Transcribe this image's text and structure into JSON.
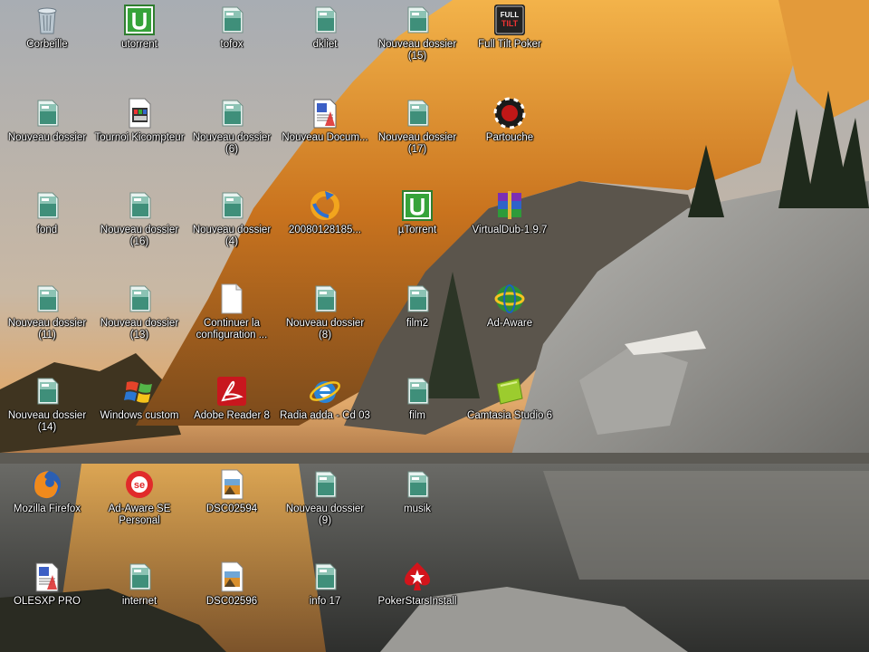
{
  "desktop": {
    "icons": [
      {
        "label": "Corbeille",
        "icon": "recycle-bin-icon",
        "col": 0,
        "row": 0
      },
      {
        "label": "Nouveau dossier",
        "icon": "folder-icon",
        "col": 0,
        "row": 1
      },
      {
        "label": "fond",
        "icon": "folder-icon",
        "col": 0,
        "row": 2
      },
      {
        "label": "Nouveau dossier (11)",
        "icon": "folder-icon",
        "col": 0,
        "row": 3
      },
      {
        "label": "Nouveau dossier (14)",
        "icon": "folder-icon",
        "col": 0,
        "row": 4
      },
      {
        "label": "Mozilla Firefox",
        "icon": "firefox-icon",
        "col": 0,
        "row": 5
      },
      {
        "label": "OLESXP PRO",
        "icon": "document-icon",
        "col": 0,
        "row": 6
      },
      {
        "label": "utorrent",
        "icon": "utorrent-icon",
        "col": 1,
        "row": 0
      },
      {
        "label": "Tournoi Kicompteur",
        "icon": "video-file-icon",
        "col": 1,
        "row": 1
      },
      {
        "label": "Nouveau dossier (16)",
        "icon": "folder-icon",
        "col": 1,
        "row": 2
      },
      {
        "label": "Nouveau dossier (13)",
        "icon": "folder-icon",
        "col": 1,
        "row": 3
      },
      {
        "label": "Windows custom",
        "icon": "windows-icon",
        "col": 1,
        "row": 4
      },
      {
        "label": "Ad-Aware SE Personal",
        "icon": "ad-aware-se-icon",
        "col": 1,
        "row": 5
      },
      {
        "label": "internet",
        "icon": "folder-icon",
        "col": 1,
        "row": 6
      },
      {
        "label": "tofox",
        "icon": "folder-icon",
        "col": 2,
        "row": 0
      },
      {
        "label": "Nouveau dossier (6)",
        "icon": "folder-icon",
        "col": 2,
        "row": 1
      },
      {
        "label": "Nouveau dossier (4)",
        "icon": "folder-icon",
        "col": 2,
        "row": 2
      },
      {
        "label": "Continuer la configuration ...",
        "icon": "blank-file-icon",
        "col": 2,
        "row": 3
      },
      {
        "label": "Adobe Reader 8",
        "icon": "adobe-reader-icon",
        "col": 2,
        "row": 4
      },
      {
        "label": "DSC02594",
        "icon": "image-file-icon",
        "col": 2,
        "row": 5
      },
      {
        "label": "DSC02596",
        "icon": "image-file-icon",
        "col": 2,
        "row": 6
      },
      {
        "label": "dkliet",
        "icon": "folder-icon",
        "col": 3,
        "row": 0
      },
      {
        "label": "Nouveau Docum...",
        "icon": "document-icon",
        "col": 3,
        "row": 1
      },
      {
        "label": "20080128185...",
        "icon": "shortcut-arrow-icon",
        "col": 3,
        "row": 2
      },
      {
        "label": "Nouveau dossier (8)",
        "icon": "folder-icon",
        "col": 3,
        "row": 3
      },
      {
        "label": "Radia adda - Cd 03",
        "icon": "internet-explorer-icon",
        "col": 3,
        "row": 4
      },
      {
        "label": "Nouveau dossier (9)",
        "icon": "folder-icon",
        "col": 3,
        "row": 5
      },
      {
        "label": "info 17",
        "icon": "folder-icon",
        "col": 3,
        "row": 6
      },
      {
        "label": "Nouveau dossier (15)",
        "icon": "folder-icon",
        "col": 4,
        "row": 0
      },
      {
        "label": "Nouveau dossier (17)",
        "icon": "folder-icon",
        "col": 4,
        "row": 1
      },
      {
        "label": "µTorrent",
        "icon": "utorrent-icon",
        "col": 4,
        "row": 2
      },
      {
        "label": "film2",
        "icon": "folder-icon",
        "col": 4,
        "row": 3
      },
      {
        "label": "film",
        "icon": "folder-icon",
        "col": 4,
        "row": 4
      },
      {
        "label": "musik",
        "icon": "folder-icon",
        "col": 4,
        "row": 5
      },
      {
        "label": "PokerStarsInstall",
        "icon": "pokerstars-icon",
        "col": 4,
        "row": 6
      },
      {
        "label": "Full Tilt Poker",
        "icon": "full-tilt-poker-icon",
        "col": 5,
        "row": 0
      },
      {
        "label": "Partouche",
        "icon": "poker-chip-icon",
        "col": 5,
        "row": 1
      },
      {
        "label": "VirtualDub-1.9.7",
        "icon": "winrar-archive-icon",
        "col": 5,
        "row": 2
      },
      {
        "label": "Ad-Aware",
        "icon": "ad-aware-icon",
        "col": 5,
        "row": 3
      },
      {
        "label": "Camtasia Studio 6",
        "icon": "camtasia-icon",
        "col": 5,
        "row": 4
      }
    ]
  }
}
